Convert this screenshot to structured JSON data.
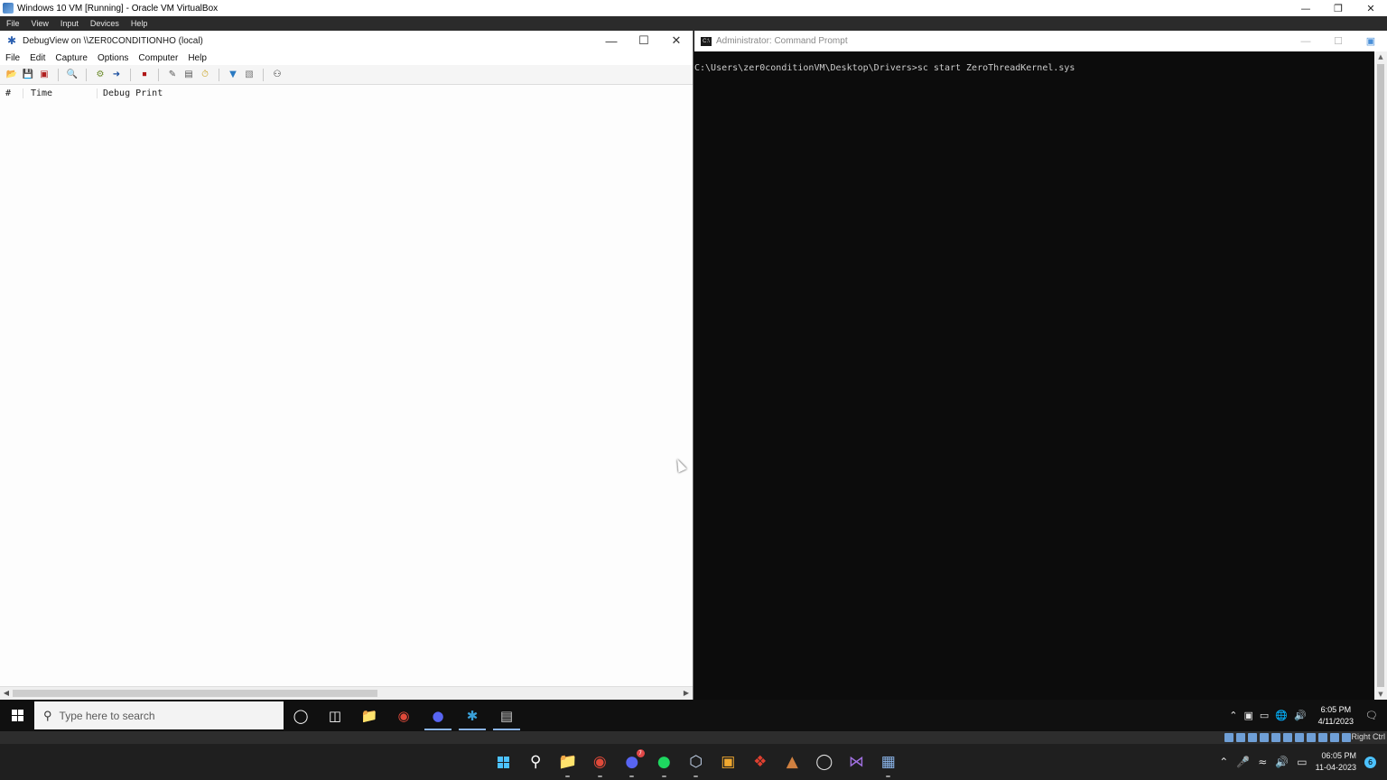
{
  "host": {
    "window_title": "Windows 10 VM [Running] - Oracle VM VirtualBox",
    "menu": [
      "File",
      "View",
      "Input",
      "Devices",
      "Help"
    ],
    "status_right": "Right Ctrl"
  },
  "debugview": {
    "title": "DebugView on \\\\ZER0CONDITIONHO (local)",
    "menu": [
      "File",
      "Edit",
      "Capture",
      "Options",
      "Computer",
      "Help"
    ],
    "columns": [
      "#",
      "Time",
      "Debug Print"
    ],
    "rows": []
  },
  "cmd": {
    "title": "Administrator: Command Prompt",
    "lines": [
      "C:\\Users\\zer0conditionVM\\Desktop\\Drivers>sc start ZeroThreadKernel.sys"
    ]
  },
  "guest_taskbar": {
    "search_placeholder": "Type here to search",
    "time": "6:05 PM",
    "date": "4/11/2023"
  },
  "host_taskbar": {
    "time": "06:05 PM",
    "date": "11-04-2023",
    "notification_count": "6",
    "discord_badge": "7"
  }
}
